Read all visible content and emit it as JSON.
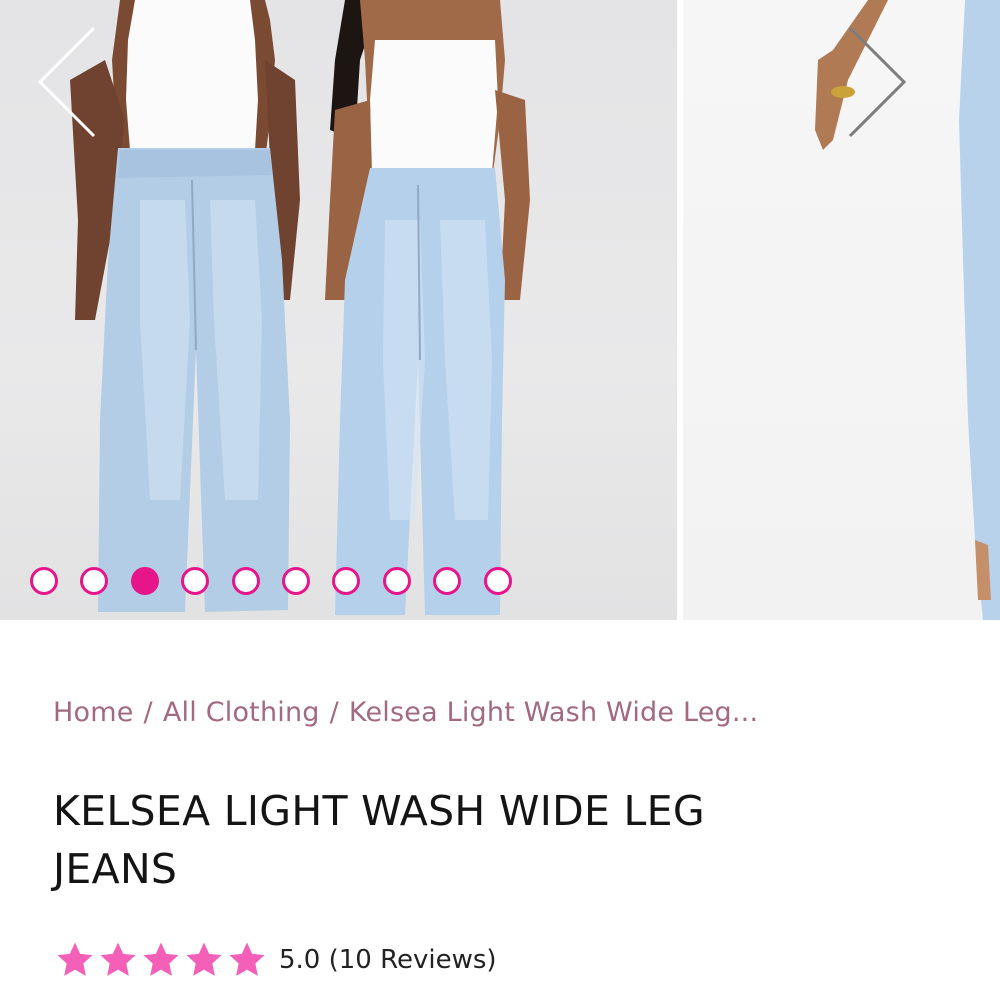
{
  "gallery": {
    "slide_count": 10,
    "active_index": 2,
    "prev_icon": "chevron-left-icon",
    "next_icon": "chevron-right-icon"
  },
  "breadcrumb": {
    "home": "Home",
    "sep1": "/",
    "category": "All Clothing",
    "sep2": "/",
    "current": "Kelsea Light Wash Wide Leg..."
  },
  "product": {
    "title_line1": "KELSEA LIGHT WASH WIDE LEG",
    "title_line2": "JEANS"
  },
  "rating": {
    "stars": 5,
    "value": "5.0",
    "reviews": "(10 Reviews)",
    "star_color": "#f45fb7",
    "star_icon": "star-icon"
  },
  "colors": {
    "accent": "#e6158a",
    "breadcrumb": "#a26a80",
    "title": "#141414"
  }
}
